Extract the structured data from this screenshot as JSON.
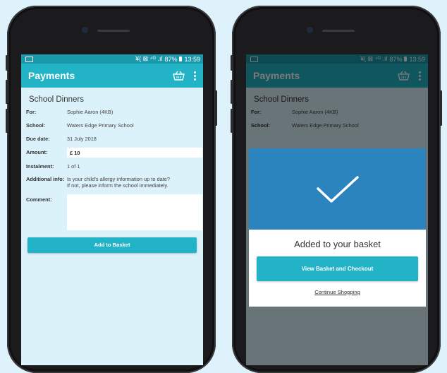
{
  "status": {
    "indicators": "¥( ⊠ ⁴ᴳ .ıl",
    "battery": "87%",
    "time": "13:59"
  },
  "appbar": {
    "title": "Payments",
    "basket_icon": "basket-icon",
    "menu_icon": "more-vert-icon"
  },
  "form": {
    "title": "School Dinners",
    "for_label": "For:",
    "for_value": "Sophie Aaron (4KB)",
    "school_label": "School:",
    "school_value": "Waters Edge Primary School",
    "due_label": "Due date:",
    "due_value": "31 July 2018",
    "amount_label": "Amount:",
    "amount_value": "£ 10",
    "instalment_label": "Instalment:",
    "instalment_value": "1 of 1",
    "info_label": "Additional info:",
    "info_line1": "Is your child's allergy information up to date?",
    "info_line2": "If not, please inform the school immediately.",
    "comment_label": "Comment:",
    "comment_value": "",
    "add_button": "Add to Basket"
  },
  "modal": {
    "icon": "checkmark-icon",
    "title": "Added to your basket",
    "checkout_button": "View Basket and Checkout",
    "continue_link": "Continue Shopping"
  },
  "colors": {
    "page_bg": "#ddf2fa",
    "appbar": "#23b3c7",
    "statusbar": "#1a98ac",
    "modal_header": "#2b84bd"
  }
}
